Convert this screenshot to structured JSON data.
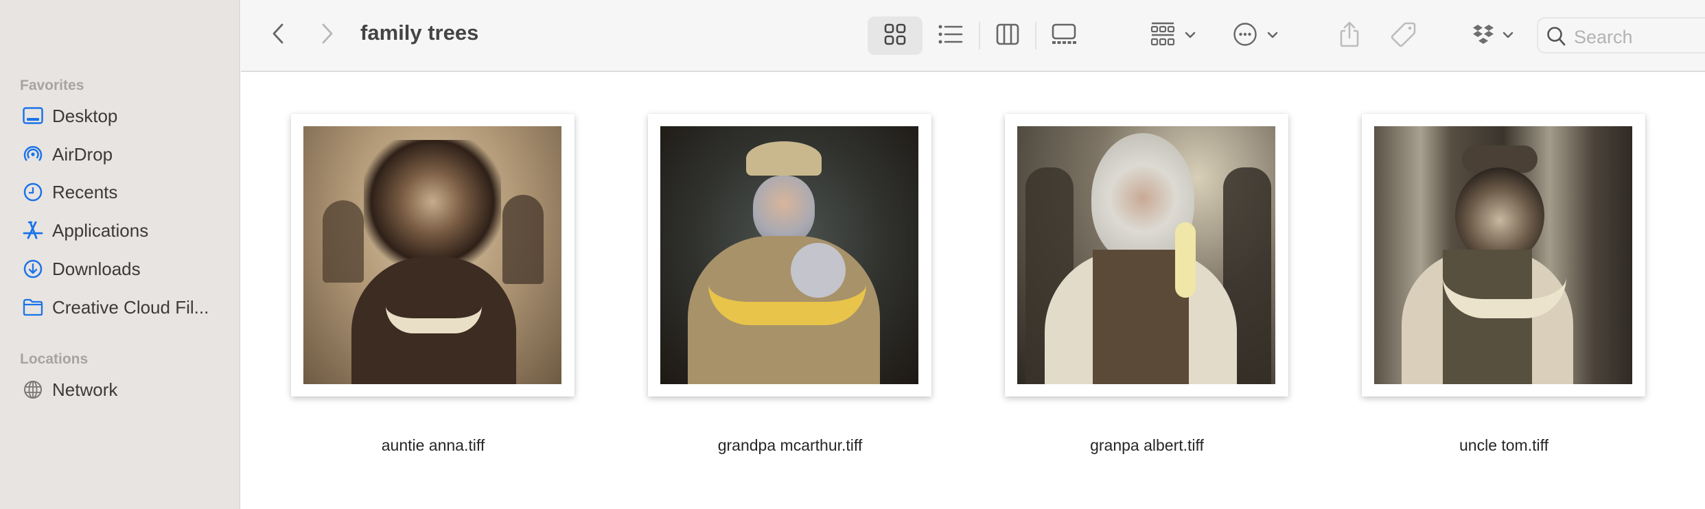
{
  "window": {
    "title": "family trees"
  },
  "sidebar": {
    "sections": [
      {
        "header": "Favorites",
        "items": [
          {
            "label": "Desktop",
            "icon": "desktop-icon"
          },
          {
            "label": "AirDrop",
            "icon": "airdrop-icon"
          },
          {
            "label": "Recents",
            "icon": "clock-icon"
          },
          {
            "label": "Applications",
            "icon": "applications-icon"
          },
          {
            "label": "Downloads",
            "icon": "download-icon"
          },
          {
            "label": "Creative Cloud Fil...",
            "icon": "folder-icon"
          }
        ]
      },
      {
        "header": "Locations",
        "items": [
          {
            "label": "Network",
            "icon": "globe-icon"
          }
        ]
      }
    ]
  },
  "toolbar": {
    "back_icon": "chevron-left-icon",
    "forward_icon": "chevron-right-icon",
    "view_modes": [
      {
        "name": "icon-view",
        "active": true
      },
      {
        "name": "list-view",
        "active": false
      },
      {
        "name": "column-view",
        "active": false
      },
      {
        "name": "gallery-view",
        "active": false
      }
    ],
    "group_icon": "group-by-icon",
    "action_icon": "ellipsis-circle-icon",
    "share_icon": "share-icon",
    "tag_icon": "tag-icon",
    "dropbox_icon": "dropbox-icon",
    "search": {
      "placeholder": "Search",
      "value": ""
    }
  },
  "colors": {
    "accent": "#1a73e8",
    "sidebar_bg": "#e8e4e1",
    "toolbar_bg": "#f6f6f6"
  },
  "files": [
    {
      "name": "auntie anna.tiff"
    },
    {
      "name": "grandpa mcarthur.tiff"
    },
    {
      "name": "granpa albert.tiff"
    },
    {
      "name": "uncle tom.tiff"
    }
  ]
}
